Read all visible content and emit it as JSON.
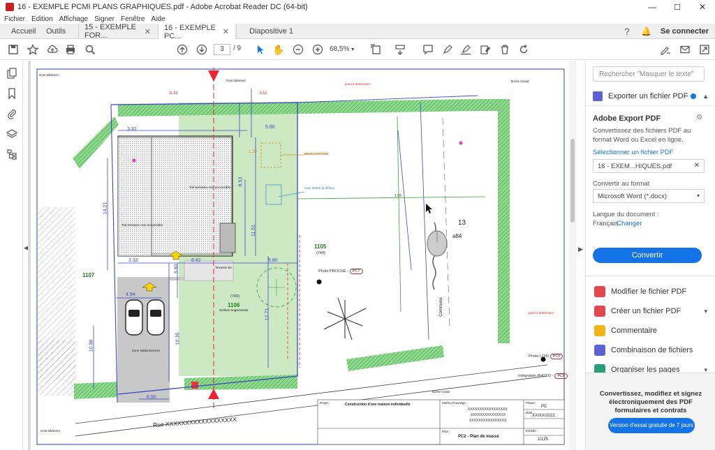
{
  "window": {
    "title": "16 - EXEMPLE PCMI PLANS GRAPHIQUES.pdf - Adobe Acrobat Reader DC (64-bit)",
    "controls": [
      "—",
      "☐",
      "✕"
    ]
  },
  "menu": [
    "Fichier",
    "Edition",
    "Affichage",
    "Signer",
    "Fenêtre",
    "Aide"
  ],
  "tabs": {
    "home": "Accueil",
    "tools": "Outils",
    "docs": [
      {
        "label": "15 - EXEMPLE FOR...",
        "closable": true,
        "active": false
      },
      {
        "label": "16 - EXEMPLE PC...",
        "closable": true,
        "active": true
      },
      {
        "label": "Diapositive 1",
        "closable": false,
        "active": false
      }
    ],
    "signin": "Se connecter"
  },
  "toolbar": {
    "page_current": "3",
    "page_total": "/ 9",
    "zoom": "68,5%"
  },
  "right_panel": {
    "search_placeholder": "Rechercher \"Masquer le texte\"",
    "export_header": "Exporter un fichier PDF",
    "export_title": "Adobe Export PDF",
    "export_desc": "Convertissez des fichiers PDF au format Word ou Excel en ligne.",
    "select_file": "Sélectionner un fichier PDF",
    "file_name": "16 - EXEM...HIQUES.pdf",
    "convert_to_label": "Convertir au format",
    "convert_to_value": "Microsoft Word (*.docx)",
    "lang_label": "Langue du document :",
    "lang_value": "Français",
    "lang_change": "Changer",
    "convert_button": "Convertir",
    "tools": [
      {
        "label": "Modifier le fichier PDF",
        "color": "#e34850",
        "expand": false
      },
      {
        "label": "Créer un fichier PDF",
        "color": "#e34850",
        "expand": true
      },
      {
        "label": "Commentaire",
        "color": "#f3b515",
        "expand": false
      },
      {
        "label": "Combinaison de fichiers",
        "color": "#5c62d6",
        "expand": false
      },
      {
        "label": "Organiser les pages",
        "color": "#2d9d78",
        "expand": true
      }
    ],
    "promo_text": "Convertissez, modifiez et signez électroniquement des PDF formulaires et contrats",
    "trial_button": "Version d'essai gratuite de 7 jours"
  },
  "plan": {
    "street": "Rue XXXXXXXXXXXXXXXXXX",
    "parcel_1107": "1107",
    "parcel_1105": "1105",
    "parcel_1105_sub": "(749)",
    "parcel_1106": "1106",
    "parcel_1106_sub": "(749)",
    "parcel_13": "13",
    "parcel_a84": "a84",
    "commune": "Commune",
    "toit_terrasse": "Toit terrasse non accessible",
    "toit_terrasse_2": "Toit terrasse non accessible",
    "terrasse_ba": "Terrasse BA",
    "zone_stationnement": "Zone stationnement",
    "surface_engazonnee": "Surface engazonnée",
    "photo_proche": "Photo PROCHE -",
    "photo_lointaine": "Photo LOIN",
    "integration_photo": "Intégration PHOTO -",
    "pc7": "PC7",
    "pc6": "PC6",
    "pc8": "PC8",
    "coin_batiment": "Coin bâtiment",
    "borne_granit": "Borne Granit",
    "point_a_determiner": "point à déterminer",
    "microstation": "MICROSTATION",
    "cuve": "cuve 3000L (à définir)",
    "dims": [
      "3.32",
      "5.80",
      "8.82",
      "3.32",
      "5.80",
      "4.94",
      "6.50",
      "14.21",
      "10.35",
      "10.96",
      "12.71",
      "11.51",
      "11.53",
      "6.53",
      "3.80",
      "1.20",
      "8.53",
      "1.99"
    ],
    "title_block": {
      "projet_label": "Projet :",
      "projet_value": "Construction d'une maison individuelle",
      "moa_label": "Maître d'ouvrage :",
      "moa_values": [
        "XXXXXXXXXXXXXXXXX",
        "XXXXXXXXXXXXXXX",
        "XXXXXXXXXXXXXXXX"
      ],
      "phase_label": "Phase :",
      "phase_value": "PC",
      "date_label": "Date :",
      "date_value": "XX/XX/2022",
      "plan_label": "Plan :",
      "plan_value": "PC2 - Plan de masse",
      "echelle_label": "Echelle :",
      "echelle_value": "1/125"
    }
  }
}
